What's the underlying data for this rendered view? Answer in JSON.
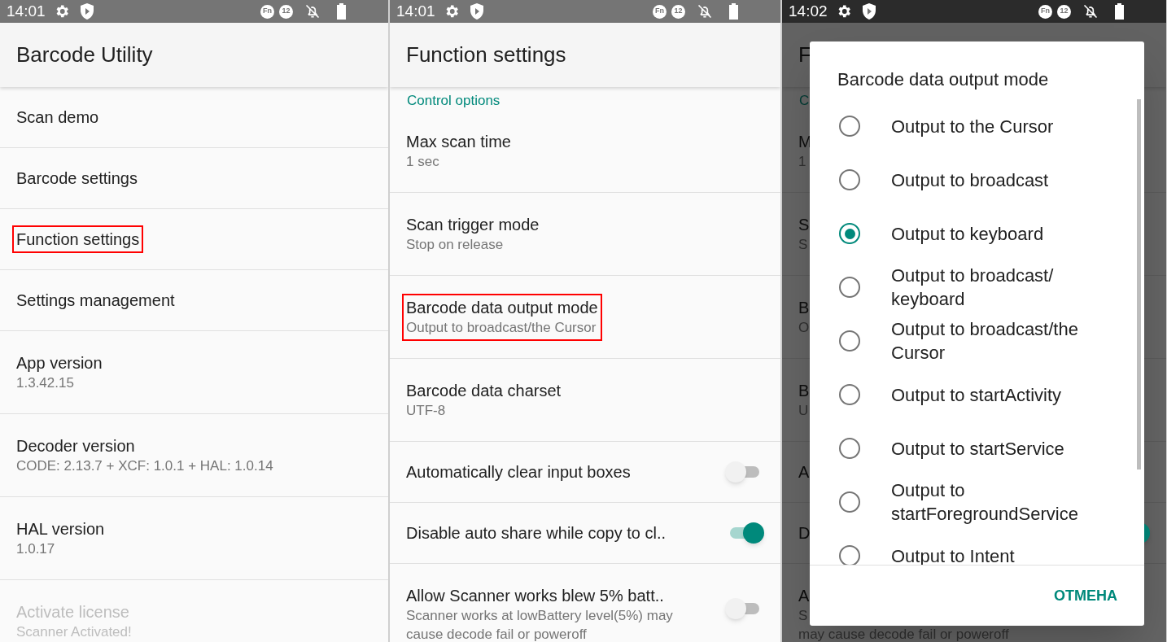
{
  "screens": [
    {
      "dimmed": false,
      "status_bar": {
        "time": "14:01",
        "indicators": [
          "Fn",
          "12"
        ]
      },
      "app_bar": {
        "title": "Barcode Utility"
      },
      "items": [
        {
          "kind": "item",
          "title": "Scan demo",
          "highlighted": false,
          "disabled": false
        },
        {
          "kind": "item",
          "title": "Barcode settings",
          "highlighted": false,
          "disabled": false
        },
        {
          "kind": "item",
          "title": "Function settings",
          "highlighted": true,
          "disabled": false
        },
        {
          "kind": "item",
          "title": "Settings management",
          "highlighted": false,
          "disabled": false
        },
        {
          "kind": "item",
          "title": "App version",
          "subtitle": [
            "1.3.42.15"
          ],
          "highlighted": false,
          "disabled": false
        },
        {
          "kind": "item",
          "title": "Decoder version",
          "subtitle": [
            "CODE: 2.13.7 + XCF: 1.0.1 + HAL: 1.0.14"
          ],
          "highlighted": false,
          "disabled": false
        },
        {
          "kind": "item",
          "title": "HAL version",
          "subtitle": [
            "1.0.17"
          ],
          "highlighted": false,
          "disabled": false
        },
        {
          "kind": "item",
          "title": "Activate license",
          "subtitle": [
            "Scanner Activated!"
          ],
          "highlighted": false,
          "disabled": true
        }
      ]
    },
    {
      "dimmed": false,
      "status_bar": {
        "time": "14:01",
        "indicators": [
          "Fn",
          "12"
        ]
      },
      "app_bar": {
        "title": "Function settings"
      },
      "items": [
        {
          "kind": "section",
          "title": "Control options"
        },
        {
          "kind": "item",
          "title": "Max scan time",
          "subtitle": [
            "1 sec"
          ],
          "highlighted": false
        },
        {
          "kind": "item",
          "title": "Scan trigger mode",
          "subtitle": [
            "Stop on release"
          ],
          "highlighted": false
        },
        {
          "kind": "item",
          "title": "Barcode data output mode",
          "subtitle": [
            "Output to broadcast/the Cursor"
          ],
          "highlighted": true
        },
        {
          "kind": "item",
          "title": "Barcode data charset",
          "subtitle": [
            "UTF-8"
          ],
          "highlighted": false
        },
        {
          "kind": "switch",
          "title": "Automatically clear input boxes",
          "on": false,
          "highlighted": false
        },
        {
          "kind": "switch",
          "title": "Disable auto share while copy to cl..",
          "on": true,
          "highlighted": false
        },
        {
          "kind": "switch",
          "title": "Allow Scanner works blew 5% batt..",
          "subtitle": [
            "Scanner works at lowBattery level(5%) may cause decode fail or poweroff"
          ],
          "on": false,
          "highlighted": false
        }
      ]
    },
    {
      "dimmed": true,
      "status_bar": {
        "time": "14:02",
        "indicators": [
          "Fn",
          "12"
        ]
      },
      "app_bar": {
        "title": "F"
      },
      "items": [
        {
          "kind": "section",
          "title": "C"
        },
        {
          "kind": "item",
          "title": "M",
          "subtitle": [
            "1"
          ]
        },
        {
          "kind": "item",
          "title": "S",
          "subtitle": [
            "S"
          ]
        },
        {
          "kind": "item",
          "title": "B",
          "subtitle": [
            "O"
          ]
        },
        {
          "kind": "item",
          "title": "B",
          "subtitle": [
            "U"
          ]
        },
        {
          "kind": "switch",
          "title": "A"
        },
        {
          "kind": "switch",
          "title": "D",
          "on": true
        },
        {
          "kind": "switch",
          "title": "A",
          "subtitle": [
            "S",
            "may cause decode fail or poweroff"
          ]
        }
      ],
      "dialog": {
        "title": "Barcode data output mode",
        "options": [
          {
            "label": "Output to the Cursor",
            "selected": false
          },
          {
            "label": "Output to broadcast",
            "selected": false
          },
          {
            "label": "Output to keyboard",
            "selected": true
          },
          {
            "label": "Output to broadcast/ keyboard",
            "selected": false
          },
          {
            "label": "Output to broadcast/the Cursor",
            "selected": false
          },
          {
            "label": "Output to startActivity",
            "selected": false
          },
          {
            "label": "Output to startService",
            "selected": false
          },
          {
            "label": "Output to startForegroundService",
            "selected": false
          },
          {
            "label": "Output to Intent",
            "selected": false
          }
        ],
        "button": "ОТМЕНА"
      }
    }
  ]
}
